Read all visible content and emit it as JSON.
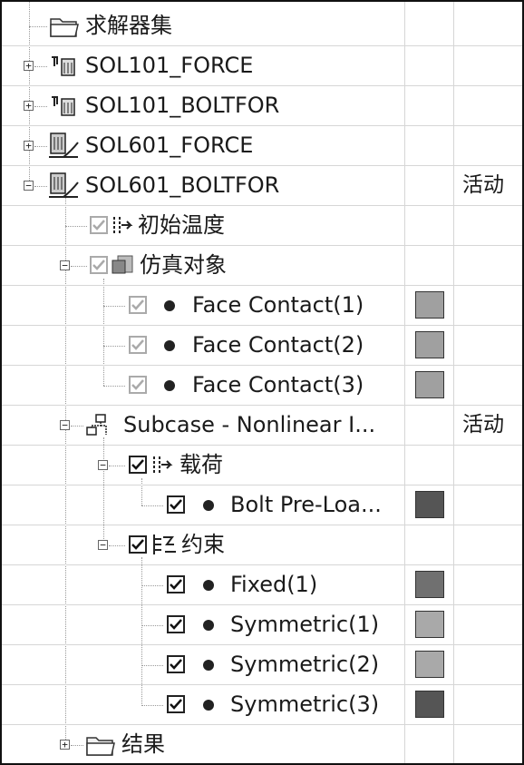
{
  "columns": {
    "status_header": "",
    "color_header": ""
  },
  "colors": {
    "swatch_light": "#a9a9a9",
    "swatch_mid": "#8a8a8a",
    "swatch_dark": "#555555"
  },
  "tree": {
    "solver_set": {
      "label": "求解器集",
      "icon": "folder-icon"
    },
    "sol101_force": {
      "label": "SOL101_FORCE",
      "icon": "solution-icon",
      "expander": "+"
    },
    "sol101_boltfor": {
      "label": "SOL101_BOLTFOR",
      "icon": "solution-icon",
      "expander": "+"
    },
    "sol601_force": {
      "label": "SOL601_FORCE",
      "icon": "nonlinear-solution-icon",
      "expander": "+"
    },
    "sol601_boltfor": {
      "label": "SOL601_BOLTFOR",
      "icon": "nonlinear-solution-icon",
      "expander": "−",
      "status": "活动"
    },
    "initial_temp": {
      "label": "初始温度",
      "icon": "temperature-icon",
      "checked": true
    },
    "sim_objects": {
      "label": "仿真对象",
      "icon": "simulation-object-icon",
      "checked": true,
      "expander": "−"
    },
    "face_contact_1": {
      "label": "Face Contact(1)",
      "checked": true,
      "color": "#a0a0a0"
    },
    "face_contact_2": {
      "label": "Face Contact(2)",
      "checked": true,
      "color": "#a0a0a0"
    },
    "face_contact_3": {
      "label": "Face Contact(3)",
      "checked": true,
      "color": "#a0a0a0"
    },
    "subcase": {
      "label": "Subcase - Nonlinear I...",
      "icon": "subcase-icon",
      "expander": "−",
      "status": "活动"
    },
    "loads": {
      "label": "载荷",
      "icon": "load-icon",
      "checked": true,
      "expander": "−"
    },
    "bolt_preload": {
      "label": "Bolt Pre-Loa...",
      "checked": true,
      "color": "#555555"
    },
    "constraints": {
      "label": "约束",
      "icon": "constraint-icon",
      "checked": true,
      "expander": "−"
    },
    "fixed_1": {
      "label": "Fixed(1)",
      "checked": true,
      "color": "#707070"
    },
    "symmetric_1": {
      "label": "Symmetric(1)",
      "checked": true,
      "color": "#a9a9a9"
    },
    "symmetric_2": {
      "label": "Symmetric(2)",
      "checked": true,
      "color": "#a9a9a9"
    },
    "symmetric_3": {
      "label": "Symmetric(3)",
      "checked": true,
      "color": "#555555"
    },
    "results": {
      "label": "结果",
      "icon": "folder-icon",
      "expander": "+"
    }
  }
}
